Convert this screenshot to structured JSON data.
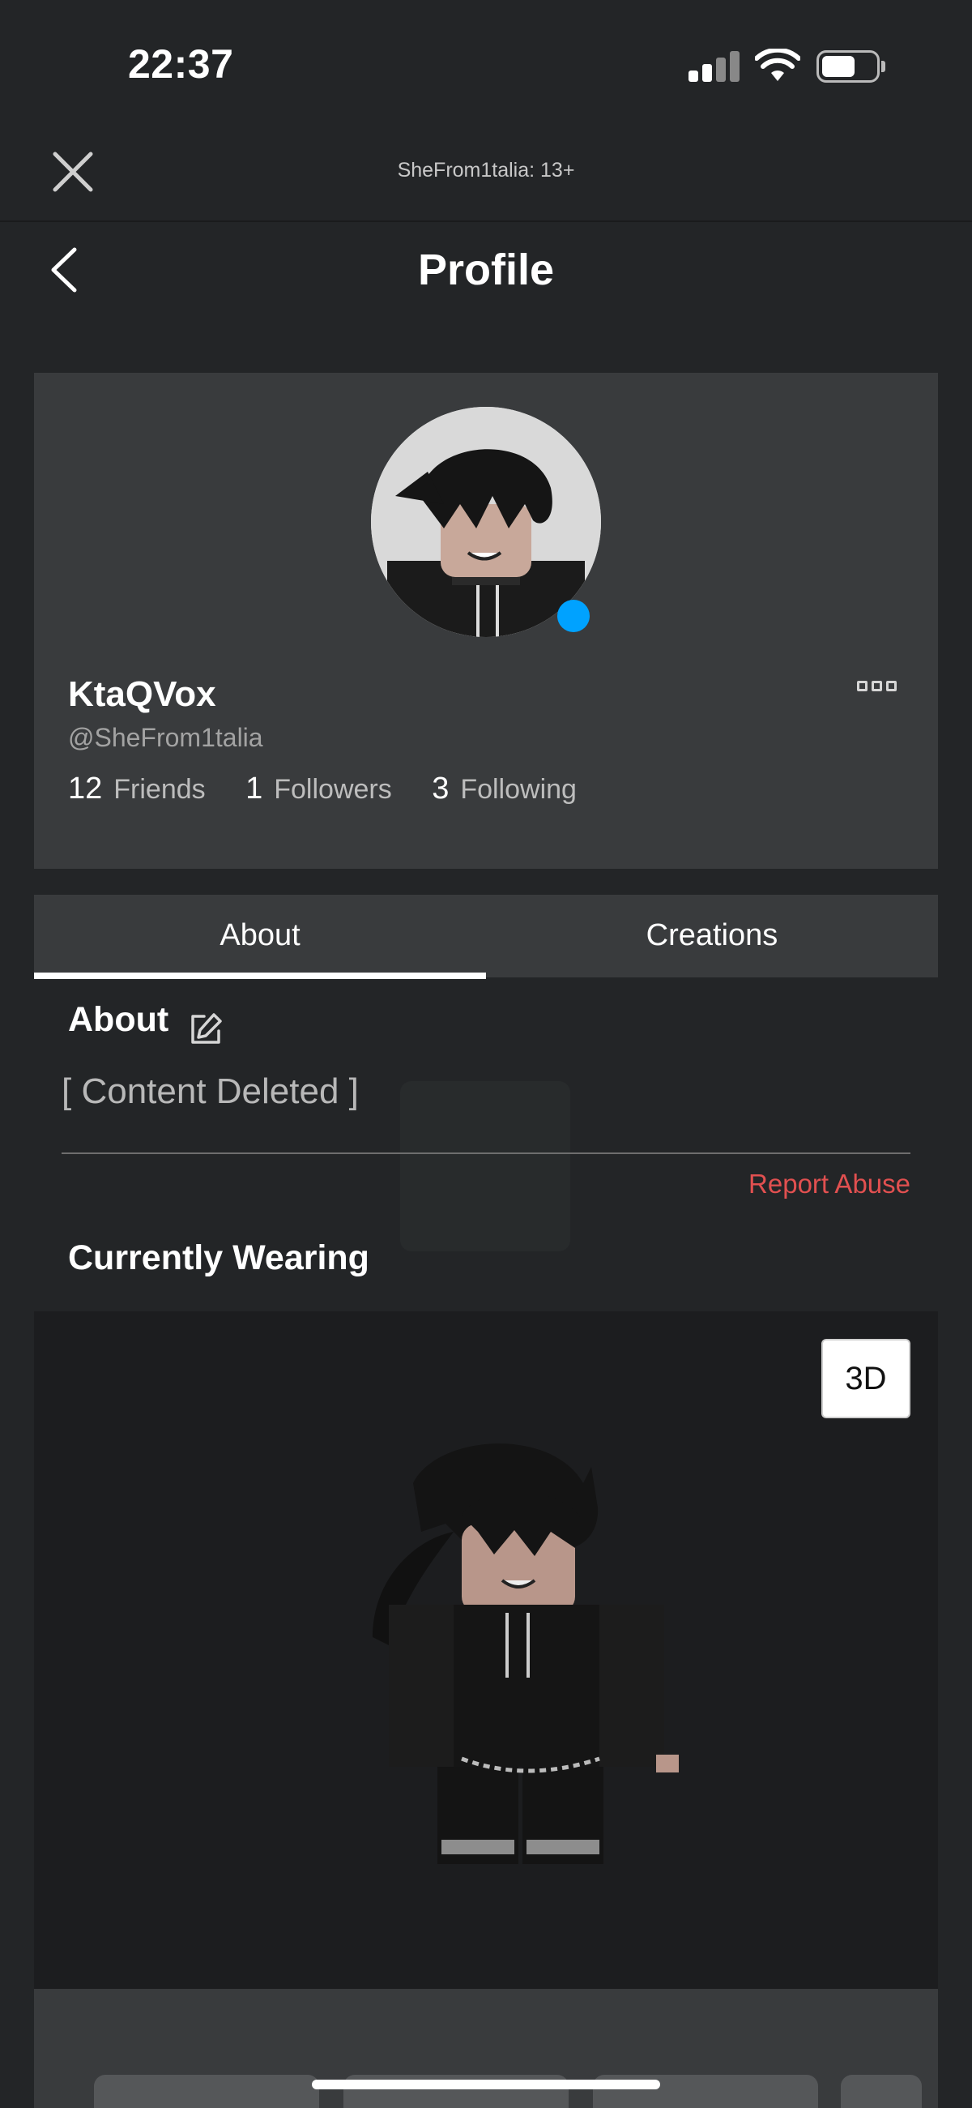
{
  "status_bar": {
    "time": "22:37",
    "signal_icon": "cellular-signal-icon",
    "wifi_icon": "wifi-icon",
    "battery_icon": "battery-icon"
  },
  "webview": {
    "title": "SheFrom1talia: 13+",
    "close_icon": "close-icon"
  },
  "header": {
    "title": "Profile",
    "back_icon": "chevron-left-icon"
  },
  "profile": {
    "display_name": "KtaQVox",
    "username": "@SheFrom1talia",
    "online_color": "#00a2ff",
    "more_icon": "more-options-icon",
    "stats": [
      {
        "count": "12",
        "label": "Friends"
      },
      {
        "count": "1",
        "label": "Followers"
      },
      {
        "count": "3",
        "label": "Following"
      }
    ]
  },
  "tabs": [
    {
      "label": "About",
      "active": true
    },
    {
      "label": "Creations",
      "active": false
    }
  ],
  "about": {
    "heading": "About",
    "edit_icon": "edit-icon",
    "text": "[ Content Deleted ]",
    "report_label": "Report Abuse",
    "report_color": "#e15050"
  },
  "wearing": {
    "heading": "Currently Wearing",
    "toggle_3d_label": "3D"
  },
  "colors": {
    "background": "#232527",
    "card": "#393b3d",
    "accent": "#00a2ff"
  }
}
